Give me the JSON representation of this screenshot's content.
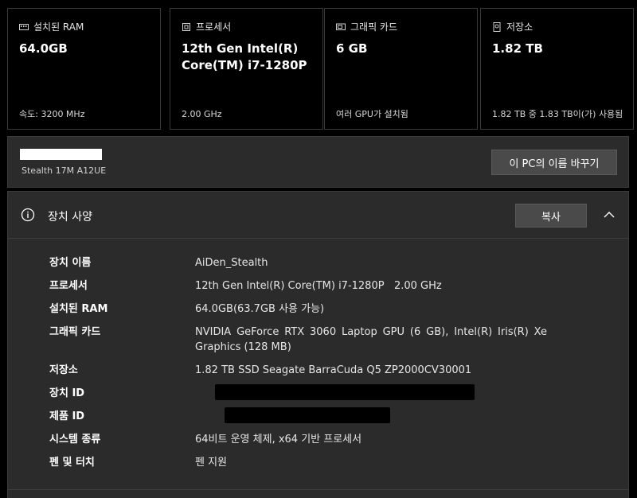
{
  "cards": [
    {
      "title": "설치된 RAM",
      "value": "64.0GB",
      "footer": "속도: 3200 MHz",
      "icon": "ram-icon"
    },
    {
      "title": "프로세서",
      "value": "12th Gen Intel(R) Core(TM) i7-1280P",
      "footer": "2.00 GHz",
      "icon": "processor-icon"
    },
    {
      "title": "그래픽 카드",
      "value": "6 GB",
      "footer": "여러 GPU가 설치됨",
      "icon": "graphics-card-icon"
    },
    {
      "title": "저장소",
      "value": "1.82 TB",
      "footer": "1.82 TB 중 1.83 TB이(가) 사용됨",
      "icon": "storage-icon"
    }
  ],
  "device": {
    "model": "Stealth 17M A12UE",
    "rename_label": "이 PC의 이름 바꾸기"
  },
  "specs": {
    "title": "장치 사양",
    "copy_label": "복사",
    "rows": [
      {
        "label": "장치 이름",
        "value": "AiDen_Stealth"
      },
      {
        "label": "프로세서",
        "value": "12th Gen Intel(R) Core(TM) i7-1280P   2.00 GHz"
      },
      {
        "label": "설치된 RAM",
        "value": "64.0GB(63.7GB 사용 가능)"
      },
      {
        "label": "그래픽 카드",
        "value": "NVIDIA GeForce RTX 3060 Laptop GPU (6 GB), Intel(R) Iris(R) Xe Graphics (128 MB)"
      },
      {
        "label": "저장소",
        "value": "1.82 TB SSD Seagate BarraCuda Q5 ZP2000CV30001"
      },
      {
        "label": "장치 ID",
        "value": ""
      },
      {
        "label": "제품 ID",
        "value": ""
      },
      {
        "label": "시스템 종류",
        "value": "64비트 운영 체제, x64 기반 프로세서"
      },
      {
        "label": "펜 및 터치",
        "value": "펜 지원"
      }
    ]
  }
}
